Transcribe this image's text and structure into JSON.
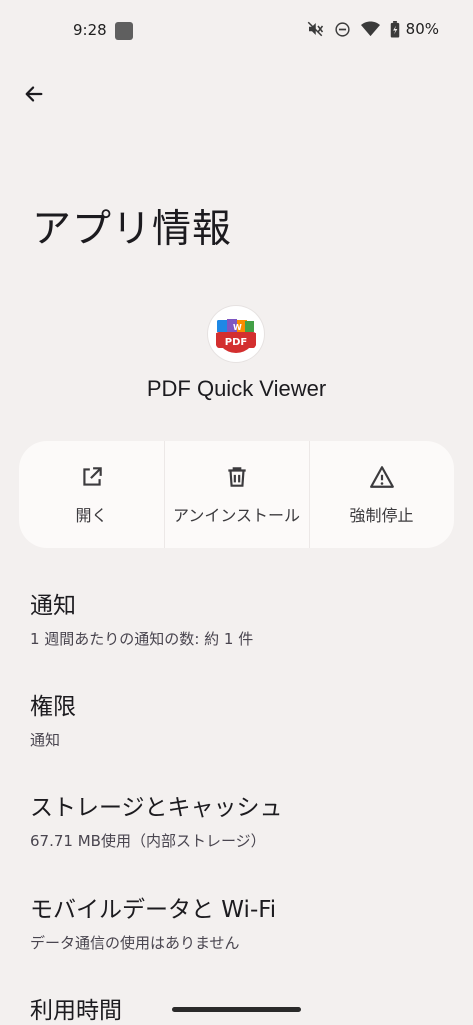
{
  "status_bar": {
    "time": "9:28",
    "battery": "80%"
  },
  "page": {
    "title": "アプリ情報"
  },
  "app": {
    "name": "PDF Quick Viewer",
    "icon_text": "PDF"
  },
  "actions": [
    {
      "label": "開く",
      "icon": "open-external-icon"
    },
    {
      "label": "アンインストール",
      "icon": "trash-icon"
    },
    {
      "label": "強制停止",
      "icon": "warning-icon"
    }
  ],
  "settings": [
    {
      "title": "通知",
      "subtitle": "1 週間あたりの通知の数: 約 1 件"
    },
    {
      "title": "権限",
      "subtitle": "通知"
    },
    {
      "title": "ストレージとキャッシュ",
      "subtitle": "67.71 MB使用（内部ストレージ）"
    },
    {
      "title": "モバイルデータと Wi-Fi",
      "subtitle": "データ通信の使用はありません"
    },
    {
      "title": "利用時間",
      "subtitle": ""
    }
  ],
  "colors": {
    "background": "#f3f0ef",
    "card": "#fcfaf9",
    "icon_red": "#d32f2f"
  }
}
